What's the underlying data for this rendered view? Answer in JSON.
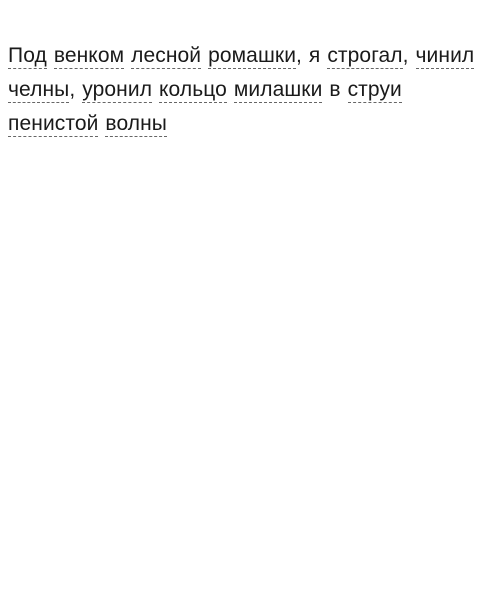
{
  "text": {
    "t1": "Под",
    "t2": "венком",
    "t3": "лесной",
    "t4": "ромашки",
    "t5": ", я ",
    "t6": "строгал",
    "t7": ", ",
    "t8": "чинил",
    "t9": "челны",
    "t10": ", ",
    "t11": "уронил",
    "t12": "кольцо",
    "t13": "милашки",
    "t14": " в ",
    "t15": "струи",
    "t16": "пенистой",
    "t17": "волны"
  }
}
